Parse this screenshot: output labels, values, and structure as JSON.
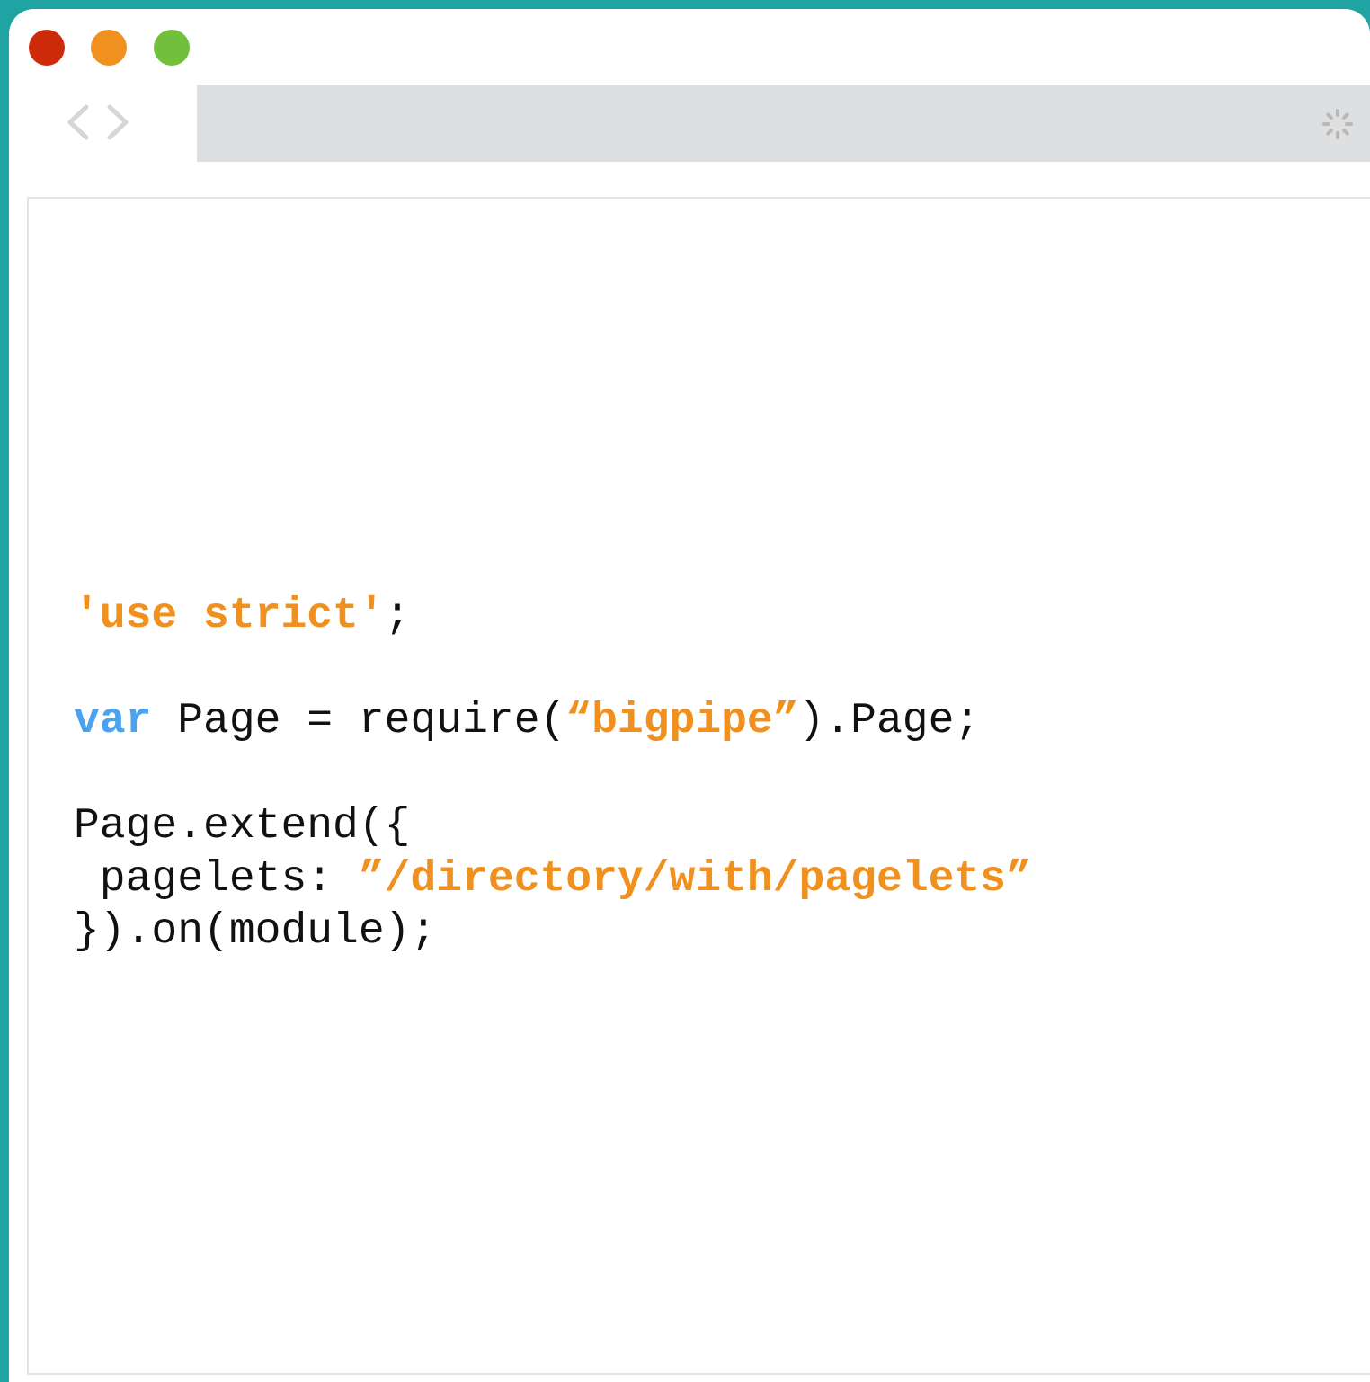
{
  "window": {
    "controls": {
      "close_color": "#cc2a0a",
      "minimize_color": "#f0901f",
      "maximize_color": "#72bf3d"
    },
    "nav": {
      "back_icon": "chevron-left-icon",
      "forward_icon": "chevron-right-icon"
    },
    "addressbar": {
      "value": "",
      "loading_icon": "loading-spinner-icon"
    }
  },
  "code": {
    "line1": {
      "str": "'use strict'",
      "rest": ";"
    },
    "line3": {
      "kw": "var",
      "a": " Page = require(",
      "str": "“bigpipe”",
      "b": ").Page;"
    },
    "line5": {
      "text": "Page.extend({"
    },
    "line6": {
      "a": " pagelets: ",
      "str": "”/directory/with/pagelets”"
    },
    "line7": {
      "text": "}).on(module);"
    }
  },
  "colors": {
    "frame": "#1fa3a3",
    "keyword": "#4ba3f0",
    "string": "#f0901f",
    "addressbar_bg": "#dedfe0"
  }
}
